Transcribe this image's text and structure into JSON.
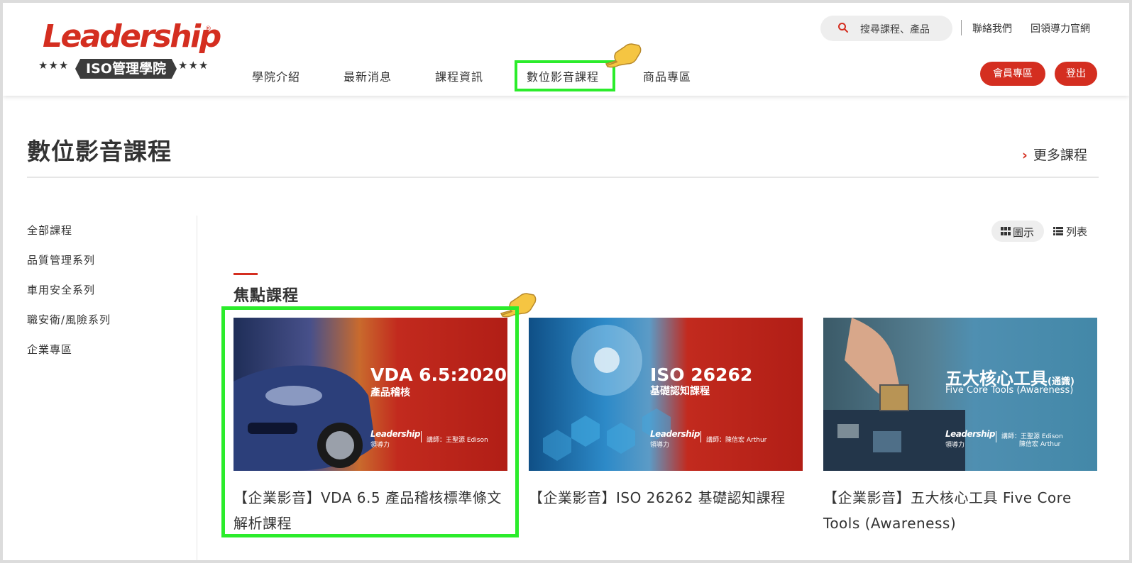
{
  "header": {
    "logo": {
      "word": "Leadership",
      "reg": "®",
      "badge": "ISO管理學院",
      "stars": "★★★"
    },
    "nav": [
      "學院介紹",
      "最新消息",
      "課程資訊",
      "數位影音課程",
      "商品專區"
    ],
    "search_placeholder": "搜尋課程、產品",
    "top_links": [
      "聯絡我們",
      "回領導力官網"
    ],
    "member_button": "會員專區",
    "logout_button": "登出"
  },
  "section": {
    "title": "數位影音課程",
    "more_link": "更多課程",
    "more_chevron": "›"
  },
  "sidebar": {
    "items": [
      "全部課程",
      "品質管理系列",
      "車用安全系列",
      "職安衛/風險系列",
      "企業專區"
    ]
  },
  "view_toggle": {
    "grid": "圖示",
    "list": "列表"
  },
  "focus": {
    "title": "焦點課程",
    "courses": [
      {
        "thumb_title": "VDA 6.5:2020",
        "thumb_subtitle": "產品稽核",
        "thumb_brand": "Leadership",
        "thumb_brand_cn": "領導力",
        "thumb_teacher": "講師：王聖源 Edison",
        "title": "【企業影音】VDA 6.5 產品稽核標準條文解析課程"
      },
      {
        "thumb_title": "ISO 26262",
        "thumb_subtitle": "基礎認知課程",
        "thumb_brand": "Leadership",
        "thumb_brand_cn": "領導力",
        "thumb_teacher": "講師：陳信宏 Arthur",
        "title": "【企業影音】ISO 26262 基礎認知課程"
      },
      {
        "thumb_title": "五大核心工具",
        "thumb_title_small": "(通識)",
        "thumb_subtitle": "Five Core Tools (Awareness)",
        "thumb_brand": "Leadership",
        "thumb_brand_cn": "領導力",
        "thumb_teacher": "講師：王聖源 Edison",
        "thumb_teacher2": "陳信宏 Arthur",
        "title": "【企業影音】五大核心工具 Five Core Tools (Awareness)"
      }
    ]
  },
  "colors": {
    "brand_red": "#d42e20",
    "highlight_green": "#2bec2b",
    "text": "#333333"
  },
  "icons": [
    "search-icon",
    "chevron-right-icon",
    "grid-view-icon",
    "list-view-icon",
    "pointing-hand-icon"
  ]
}
